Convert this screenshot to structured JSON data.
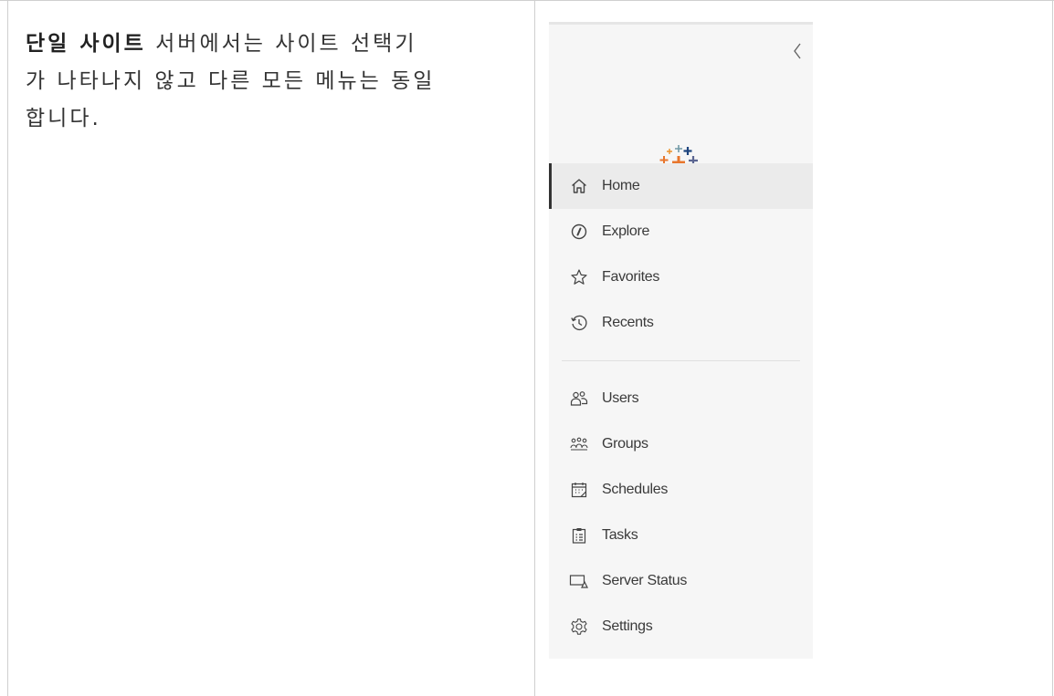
{
  "description": {
    "bold_text": "단일 사이트",
    "line1_rest": " 서버에서는 사이트 선택기",
    "line2": "가 나타나지 않고 다른 모든 메뉴는 동일",
    "line3": "합니다."
  },
  "sidebar": {
    "collapse_glyph": "‹",
    "primary_items": [
      {
        "label": "Home",
        "icon": "home-icon",
        "active": true
      },
      {
        "label": "Explore",
        "icon": "compass-icon",
        "active": false
      },
      {
        "label": "Favorites",
        "icon": "star-icon",
        "active": false
      },
      {
        "label": "Recents",
        "icon": "history-icon",
        "active": false
      }
    ],
    "admin_items": [
      {
        "label": "Users",
        "icon": "users-icon"
      },
      {
        "label": "Groups",
        "icon": "groups-icon"
      },
      {
        "label": "Schedules",
        "icon": "calendar-icon"
      },
      {
        "label": "Tasks",
        "icon": "clipboard-icon"
      },
      {
        "label": "Server Status",
        "icon": "server-status-icon"
      },
      {
        "label": "Settings",
        "icon": "gear-icon"
      }
    ]
  },
  "colors": {
    "nav_background": "#f6f6f6",
    "active_item_background": "#ebebeb",
    "active_indicator": "#333333",
    "logo_orange": "#e8762d",
    "logo_blue": "#1f457e",
    "logo_red": "#c72035",
    "logo_teal": "#59879b",
    "logo_lightblue": "#5b6591"
  }
}
